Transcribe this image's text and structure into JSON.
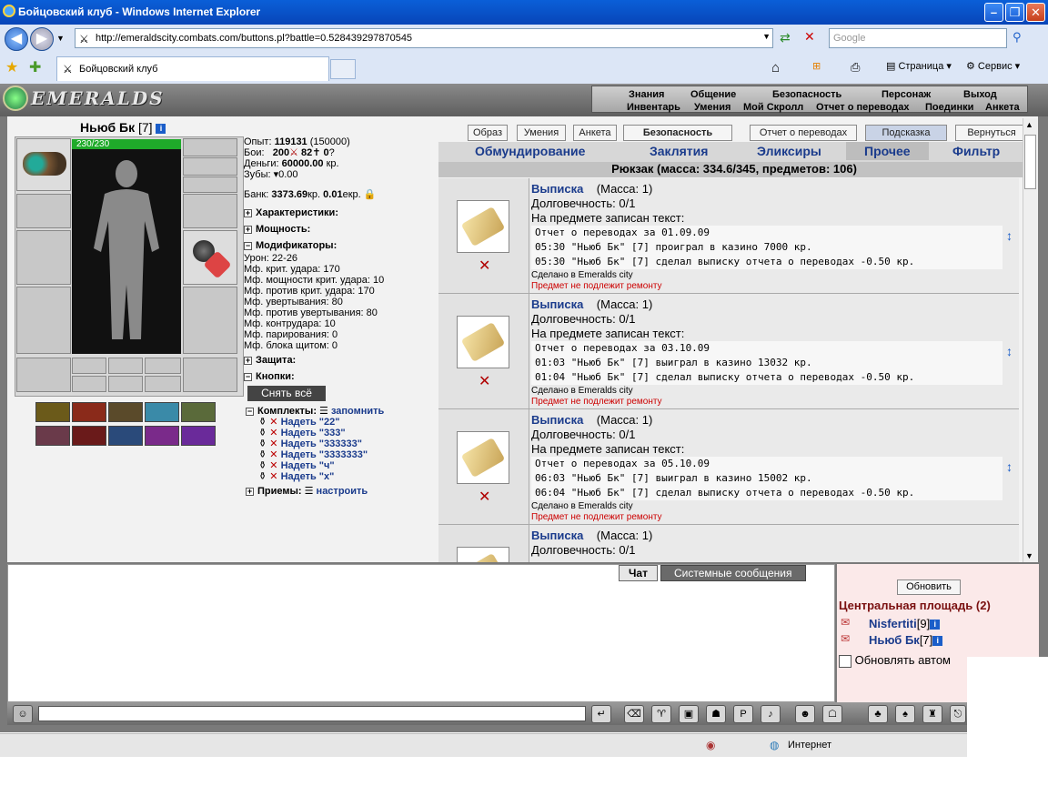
{
  "window": {
    "title": "Бойцовский клуб - Windows Internet Explorer"
  },
  "browser": {
    "url": "http://emeraldscity.combats.com/buttons.pl?battle=0.528439297870545",
    "search_placeholder": "Google",
    "tab_title": "Бойцовский клуб",
    "page_menu": "Страница",
    "service_menu": "Сервис",
    "status_zone": "Интернет"
  },
  "game": {
    "logo": "EMERALDS",
    "nav_top": [
      "Знания",
      "Общение",
      "Безопасность",
      "Персонаж",
      "Выход"
    ],
    "nav_bottom": [
      "Инвентарь",
      "Умения",
      "Мой Скролл",
      "Отчет о переводах",
      "Поединки",
      "Анкета"
    ],
    "buttons": [
      "Образ",
      "Умения",
      "Анкета",
      "Безопасность",
      "Отчет о переводах",
      "Подсказка",
      "Вернуться"
    ],
    "character": {
      "name": "Ньюб Бк",
      "level": "[7]",
      "hp": "230/230",
      "exp_label": "Опыт:",
      "exp": "119131",
      "exp_next": "(150000)",
      "fights_label": "Бои:",
      "wins": "200",
      "losses": "82",
      "draws": "0",
      "money_label": "Деньги:",
      "money": "60000.00",
      "money_unit": "кр.",
      "teeth_label": "Зубы:",
      "teeth": "0.00",
      "bank_label": "Банк:",
      "bank": "3373.69",
      "bank_unit": "кр.",
      "bank_ekr": "0.01",
      "bank_ekr_unit": "екр."
    },
    "sections": {
      "characteristics": "Характеристики:",
      "power": "Мощность:",
      "modifiers": "Модификаторы:",
      "protection": "Защита:",
      "buttons": "Кнопки:",
      "sets": "Комплекты:",
      "sets_link": "запомнить",
      "techniques": "Приемы:",
      "techniques_link": "настроить"
    },
    "modifiers": [
      "Урон: 22-26",
      "Мф. крит. удара: 170",
      "Мф. мощности крит. удара: 10",
      "Мф. против крит. удара: 170",
      "Мф. увертывания: 80",
      "Мф. против увертывания: 80",
      "Мф. контрудара: 10",
      "Мф. парирования: 0",
      "Мф. блока щитом: 0"
    ],
    "remove_all": "Снять всё",
    "sets_list": [
      "Надеть \"22\"",
      "Надеть \"333\"",
      "Надеть \"333333\"",
      "Надеть \"3333333\"",
      "Надеть \"ч\"",
      "Надеть \"х\""
    ],
    "inventory_tabs": [
      "Обмундирование",
      "Заклятия",
      "Эликсиры",
      "Прочее",
      "Фильтр"
    ],
    "inventory_header": "Рюкзак (масса: 334.6/345, предметов: 106)",
    "items": [
      {
        "name": "Выписка",
        "mass": "(Масса: 1)",
        "durability": "Долговечность: 0/1",
        "text_label": "На предмете записан текст:",
        "text": "Отчет о переводах за 01.09.09\n05:30 \"Ньюб Бк\" [7] проиграл в казино 7000 кр.\n05:30 \"Ньюб Бк\" [7] сделал выписку отчета о переводах -0.50 кр.",
        "made": "Сделано в Emeralds city",
        "repair": "Предмет не подлежит ремонту"
      },
      {
        "name": "Выписка",
        "mass": "(Масса: 1)",
        "durability": "Долговечность: 0/1",
        "text_label": "На предмете записан текст:",
        "text": "Отчет о переводах за 03.10.09\n01:03 \"Ньюб Бк\" [7] выиграл в казино 13032 кр.\n01:04 \"Ньюб Бк\" [7] сделал выписку отчета о переводах -0.50 кр.",
        "made": "Сделано в Emeralds city",
        "repair": "Предмет не подлежит ремонту"
      },
      {
        "name": "Выписка",
        "mass": "(Масса: 1)",
        "durability": "Долговечность: 0/1",
        "text_label": "На предмете записан текст:",
        "text": "Отчет о переводах за 05.10.09\n06:03 \"Ньюб Бк\" [7] выиграл в казино 15002 кр.\n06:04 \"Ньюб Бк\" [7] сделал выписку отчета о переводах -0.50 кр.",
        "made": "Сделано в Emeralds city",
        "repair": "Предмет не подлежит ремонту"
      },
      {
        "name": "Выписка",
        "mass": "(Масса: 1)",
        "durability": "Долговечность: 0/1"
      }
    ],
    "chat_tabs": [
      "Чат",
      "Системные сообщения"
    ],
    "refresh": "Обновить",
    "location": "Центральная площадь (2)",
    "online": [
      {
        "name": "Nisfertiti",
        "level": "[9]"
      },
      {
        "name": "Ньюб Бк",
        "level": "[7]"
      }
    ],
    "auto_refresh": "Обновлять автом"
  }
}
